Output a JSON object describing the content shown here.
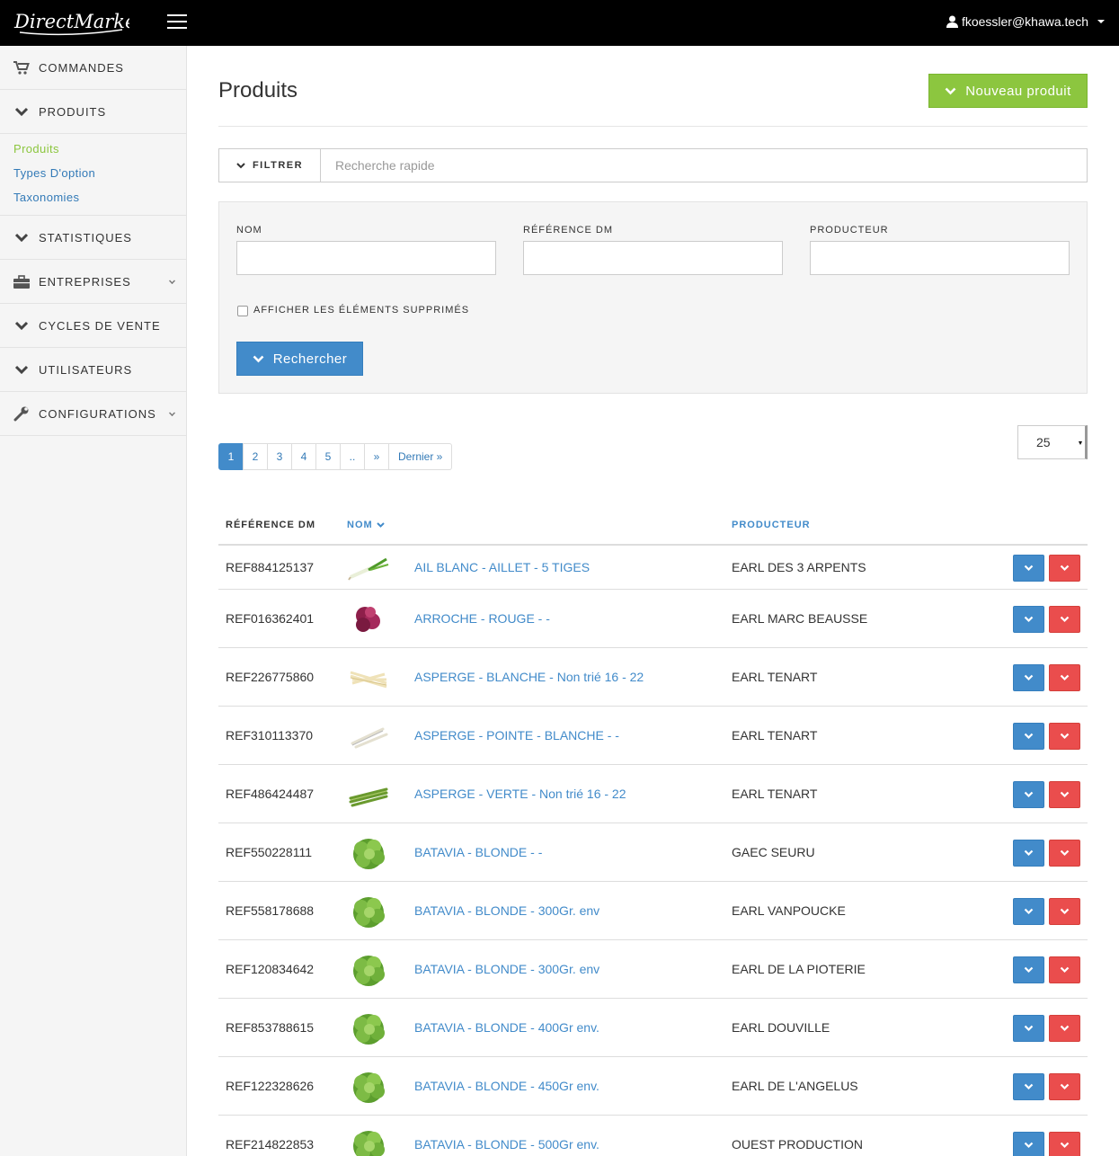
{
  "header": {
    "logo_text": "DirectMarket",
    "user_email": "fkoessler@khawa.tech"
  },
  "sidebar": {
    "items": [
      {
        "label": "COMMANDES",
        "icon": "cart-icon"
      },
      {
        "label": "PRODUITS",
        "icon": "chevron-down-icon"
      },
      {
        "label": "STATISTIQUES",
        "icon": "chevron-down-icon"
      },
      {
        "label": "ENTREPRISES",
        "icon": "briefcase-icon"
      },
      {
        "label": "CYCLES DE VENTE",
        "icon": "chevron-down-icon"
      },
      {
        "label": "UTILISATEURS",
        "icon": "chevron-down-icon"
      },
      {
        "label": "CONFIGURATIONS",
        "icon": "wrench-icon"
      }
    ],
    "subitems": [
      {
        "label": "Produits"
      },
      {
        "label": "Types D'option"
      },
      {
        "label": "Taxonomies"
      }
    ]
  },
  "page": {
    "title": "Produits",
    "new_button": "Nouveau produit"
  },
  "filter": {
    "button": "FILTRER",
    "quick_search_placeholder": "Recherche rapide",
    "fields": [
      {
        "label": "NOM",
        "value": ""
      },
      {
        "label": "RÉFÉRENCE DM",
        "value": ""
      },
      {
        "label": "PRODUCTEUR",
        "value": ""
      }
    ],
    "show_deleted_label": "AFFICHER LES ÉLÉMENTS SUPPRIMÉS",
    "show_deleted_checked": false,
    "search_button": "Rechercher"
  },
  "pagination": {
    "pages": [
      "1",
      "2",
      "3",
      "4",
      "5",
      "..",
      "»",
      "Dernier »"
    ],
    "current": "1",
    "per_page": "25"
  },
  "table": {
    "columns": [
      "RÉFÉRENCE DM",
      "NOM",
      "PRODUCTEUR"
    ],
    "rows": [
      {
        "ref": "REF884125137",
        "name": "AIL BLANC - AILLET - 5 TIGES",
        "producer": "EARL DES 3 ARPENTS",
        "img": "leek-image"
      },
      {
        "ref": "REF016362401",
        "name": "ARROCHE - ROUGE - -",
        "producer": "EARL MARC BEAUSSE",
        "img": "red-orach-image"
      },
      {
        "ref": "REF226775860",
        "name": "ASPERGE - BLANCHE - Non trié 16 - 22",
        "producer": "EARL TENART",
        "img": "white-asparagus-image"
      },
      {
        "ref": "REF310113370",
        "name": "ASPERGE - POINTE - BLANCHE - -",
        "producer": "EARL TENART",
        "img": "asparagus-tips-image"
      },
      {
        "ref": "REF486424487",
        "name": "ASPERGE - VERTE - Non trié 16 - 22",
        "producer": "EARL TENART",
        "img": "green-asparagus-image"
      },
      {
        "ref": "REF550228111",
        "name": "BATAVIA - BLONDE - -",
        "producer": "GAEC SEURU",
        "img": "lettuce-image"
      },
      {
        "ref": "REF558178688",
        "name": "BATAVIA - BLONDE - 300Gr. env",
        "producer": "EARL VANPOUCKE",
        "img": "lettuce-image"
      },
      {
        "ref": "REF120834642",
        "name": "BATAVIA - BLONDE - 300Gr. env",
        "producer": "EARL DE LA PIOTERIE",
        "img": "lettuce-image"
      },
      {
        "ref": "REF853788615",
        "name": "BATAVIA - BLONDE - 400Gr env.",
        "producer": "EARL DOUVILLE",
        "img": "lettuce-image"
      },
      {
        "ref": "REF122328626",
        "name": "BATAVIA - BLONDE - 450Gr env.",
        "producer": "EARL DE L'ANGELUS",
        "img": "lettuce-image"
      },
      {
        "ref": "REF214822853",
        "name": "BATAVIA - BLONDE - 500Gr env.",
        "producer": "OUEST PRODUCTION",
        "img": "lettuce-image"
      }
    ]
  },
  "colors": {
    "green": "#8cc63f",
    "blue": "#428bca",
    "red": "#ea4d4d",
    "topbar": "#000000"
  }
}
